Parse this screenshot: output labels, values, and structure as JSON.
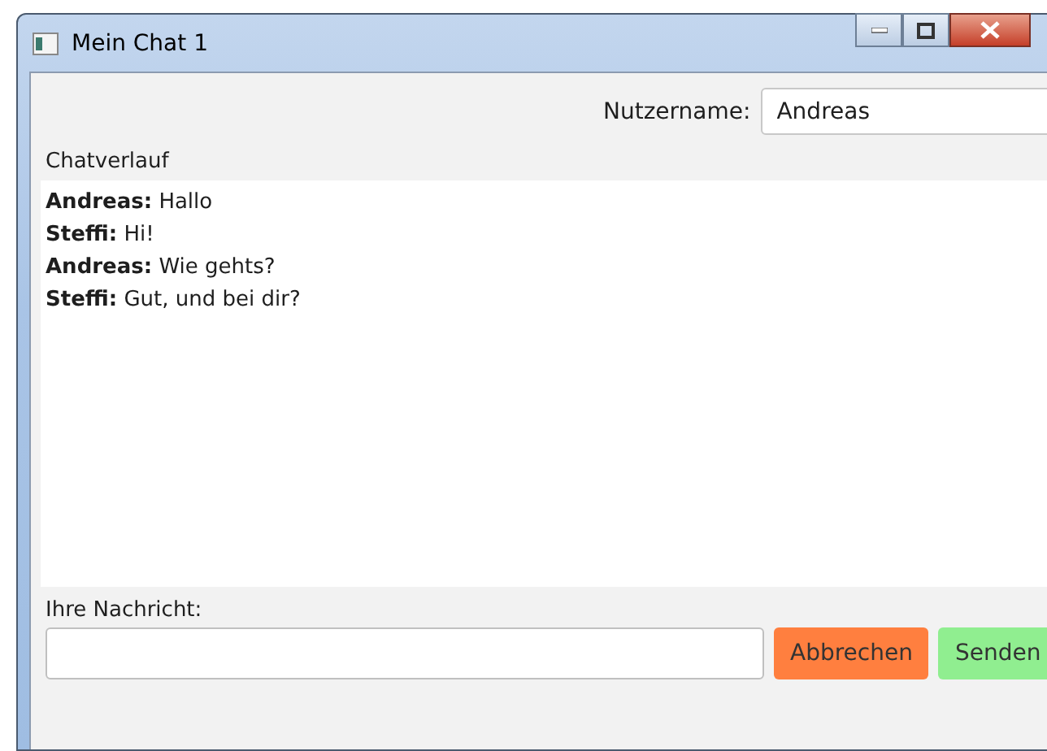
{
  "window": {
    "title": "Mein Chat 1"
  },
  "username": {
    "label": "Nutzername:",
    "value": "Andreas"
  },
  "history": {
    "label": "Chatverlauf",
    "messages": [
      {
        "text": "**Andreas:** Hallo"
      },
      {
        "text": "**Steffi:** Hi!"
      },
      {
        "text": "**Andreas:** Wie gehts?"
      },
      {
        "text": "**Steffi:** Gut, und bei dir?"
      }
    ]
  },
  "message": {
    "label": "Ihre Nachricht:"
  },
  "buttons": [
    {
      "label": "Abbrechen",
      "color": "#ff7f3f"
    },
    {
      "label": "Senden",
      "color": "#90ee90"
    }
  ]
}
